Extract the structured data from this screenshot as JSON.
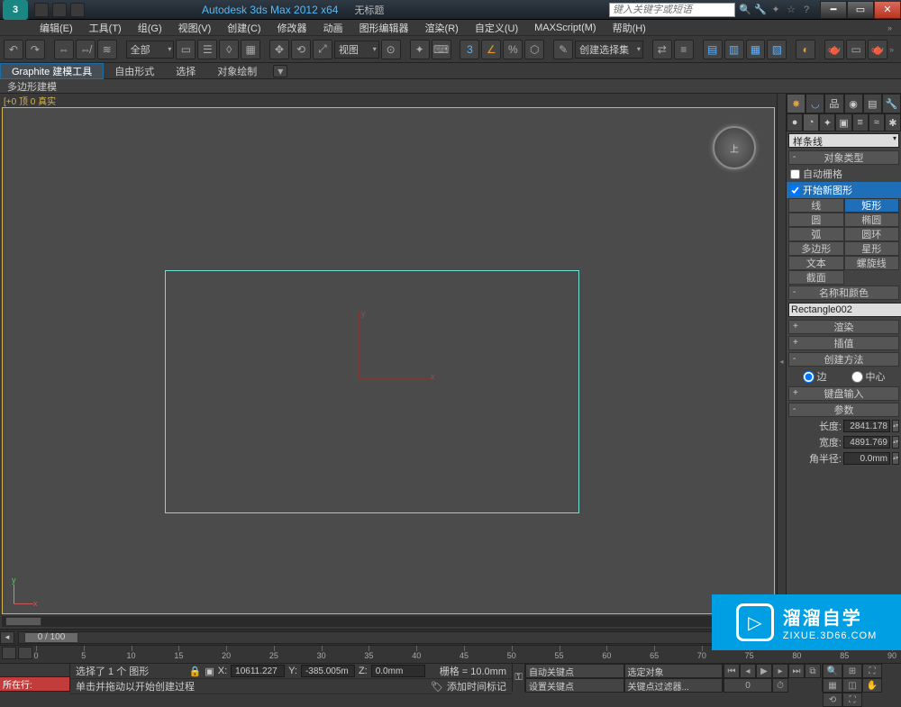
{
  "title": {
    "app": "Autodesk 3ds Max  2012 x64",
    "document": "无标题"
  },
  "search_placeholder": "键入关键字或短语",
  "menu": [
    "编辑(E)",
    "工具(T)",
    "组(G)",
    "视图(V)",
    "创建(C)",
    "修改器",
    "动画",
    "图形编辑器",
    "渲染(R)",
    "自定义(U)",
    "MAXScript(M)",
    "帮助(H)"
  ],
  "toolbar": {
    "scope_combo": "全部",
    "view_combo": "视图",
    "selection_set": "创建选择集"
  },
  "ribbon": {
    "tabs": [
      "Graphite 建模工具",
      "自由形式",
      "选择",
      "对象绘制"
    ],
    "active": 0,
    "sub": "多边形建模"
  },
  "viewport": {
    "label": "[+0 顶 0 真实",
    "cube_face": "上",
    "frame_indicator": "0 / 100"
  },
  "command_panel": {
    "dropdown": "样条线",
    "rollouts": {
      "object_type": {
        "header": "对象类型",
        "auto_grid": "自动栅格",
        "start_new_shape": "开始新图形",
        "buttons": [
          [
            "线",
            "矩形"
          ],
          [
            "圆",
            "椭圆"
          ],
          [
            "弧",
            "圆环"
          ],
          [
            "多边形",
            "星形"
          ],
          [
            "文本",
            "螺旋线"
          ],
          [
            "截面",
            ""
          ]
        ],
        "active": "矩形"
      },
      "name_color": {
        "header": "名称和颜色",
        "name": "Rectangle002"
      },
      "render": "渲染",
      "interp": "插值",
      "creation": {
        "header": "创建方法",
        "opt_edge": "边",
        "opt_center": "中心",
        "selected": "edge"
      },
      "keyboard": "键盘输入",
      "params": {
        "header": "参数",
        "length_label": "长度:",
        "length_value": "2841.178",
        "width_label": "宽度:",
        "width_value": "4891.769",
        "corner_label": "角半径:",
        "corner_value": "0.0mm"
      }
    }
  },
  "ruler": {
    "ticks": [
      0,
      5,
      10,
      15,
      20,
      25,
      30,
      35,
      40,
      45,
      50,
      55,
      60,
      65,
      70,
      75,
      80,
      85,
      90
    ]
  },
  "status": {
    "maxscript_btn": "所在行:",
    "selection_info": "选择了 1 个 图形",
    "hint": "单击并拖动以开始创建过程",
    "x_label": "X:",
    "x_val": "10611.227",
    "y_label": "Y:",
    "y_val": "-385.005m",
    "z_label": "Z:",
    "z_val": "0.0mm",
    "grid": "栅格 = 10.0mm",
    "add_time_tag": "添加时间标记",
    "auto_key": "自动关键点",
    "sel_lock": "选定对象",
    "set_key": "设置关键点",
    "key_filters": "关键点过滤器..."
  },
  "watermark": {
    "brand": "溜溜自学",
    "url": "ZIXUE.3D66.COM"
  }
}
